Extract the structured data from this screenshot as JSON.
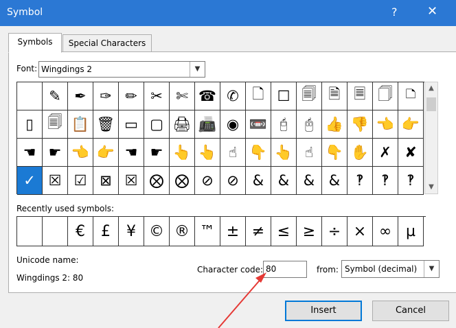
{
  "window": {
    "title": "Symbol",
    "help_glyph": "?",
    "close_glyph": "✕"
  },
  "tabs": [
    {
      "label": "Symbols",
      "active": true
    },
    {
      "label": "Special Characters",
      "active": false
    }
  ],
  "font": {
    "label": "Font:",
    "value": "Wingdings 2"
  },
  "symbol_grid": {
    "selected_index": 48,
    "rows": [
      [
        "",
        "✎",
        "✒",
        "✑",
        "✏",
        "✂",
        "✄",
        "☎",
        "✆",
        "🗋",
        "☐",
        "🗐",
        "🗎",
        "🗏",
        "🗍",
        "🗅"
      ],
      [
        "▯",
        "🗐",
        "📋",
        "🗑",
        "▭",
        "▢",
        "🖨",
        "📠",
        "◉",
        "📼",
        "🖯",
        "🖰",
        "👍",
        "👎",
        "👈",
        "👉"
      ],
      [
        "☚",
        "☛",
        "👈",
        "👉",
        "☚",
        "☛",
        "👆",
        "👆",
        "☝",
        "👇",
        "👆",
        "☝",
        "👇",
        "✋",
        "✗",
        "✘"
      ],
      [
        "✓",
        "☒",
        "☑",
        "⊠",
        "☒",
        "⨂",
        "⨂",
        "⊘",
        "⊘",
        "&",
        "&",
        "&",
        "&",
        "‽",
        "‽",
        "‽"
      ]
    ]
  },
  "recent": {
    "label": "Recently used symbols:",
    "symbols": [
      "",
      "",
      "€",
      "£",
      "¥",
      "©",
      "®",
      "™",
      "±",
      "≠",
      "≤",
      "≥",
      "÷",
      "×",
      "∞",
      "µ"
    ]
  },
  "unicode": {
    "label": "Unicode name:",
    "value": "Wingdings 2: 80"
  },
  "char_code": {
    "label": "Character code:",
    "value": "80"
  },
  "from": {
    "label": "from:",
    "value": "Symbol (decimal)"
  },
  "buttons": {
    "insert": "Insert",
    "cancel": "Cancel"
  },
  "colors": {
    "titlebar": "#2b78d4",
    "selection": "#1b7ad4",
    "annotation_arrow": "#e53935"
  }
}
